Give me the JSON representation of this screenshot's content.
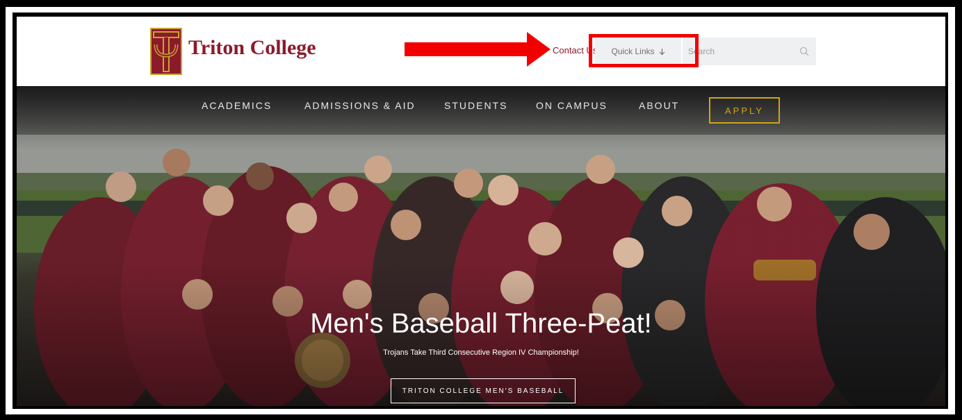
{
  "header": {
    "logo_text": "Triton College",
    "contact_label": "Contact Us",
    "quick_links_label": "Quick Links",
    "search_placeholder": "Search"
  },
  "nav": {
    "items": [
      "ACADEMICS",
      "ADMISSIONS & AID",
      "STUDENTS",
      "ON CAMPUS",
      "ABOUT"
    ],
    "apply_label": "APPLY"
  },
  "hero": {
    "headline": "Men's Baseball Three-Peat!",
    "subheadline": "Trojans Take Third Consecutive Region IV Championship!",
    "cta_label": "TRITON COLLEGE MEN'S BASEBALL"
  },
  "colors": {
    "brand": "#8b1a2b",
    "gold": "#d4a316",
    "annotation": "#f20000"
  },
  "icons": {
    "search": "search-icon",
    "quick_links": "arrow-down-icon",
    "logo": "triton-logo-icon"
  }
}
